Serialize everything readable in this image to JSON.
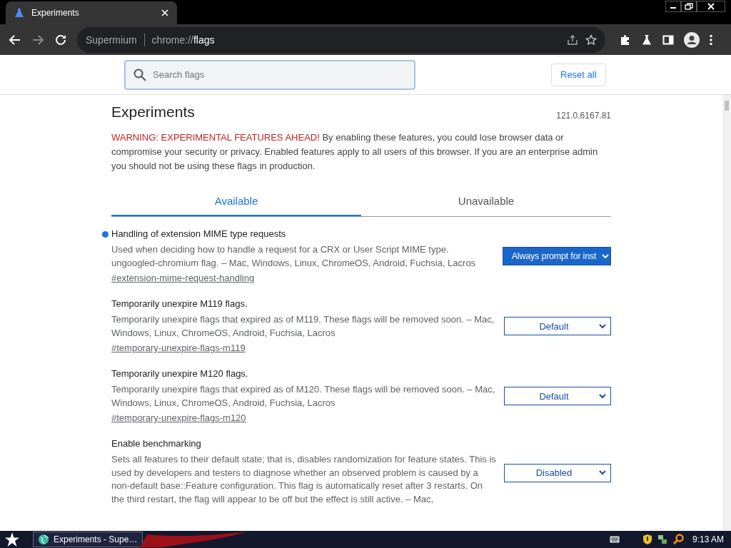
{
  "tab": {
    "title": "Experiments"
  },
  "omnibox": {
    "site": "Supermium",
    "url_prefix": "chrome://",
    "url_host": "flags"
  },
  "search": {
    "placeholder": "Search flags"
  },
  "reset_button": "Reset all",
  "page": {
    "title": "Experiments",
    "version": "121.0.6167.81",
    "warning": "WARNING: EXPERIMENTAL FEATURES AHEAD!",
    "warning_text": "By enabling these features, you could lose browser data or compromise your security or privacy. Enabled features apply to all users of this browser. If you are an enterprise admin you should not be using these flags in production."
  },
  "tabs": [
    {
      "label": "Available",
      "selected": true
    },
    {
      "label": "Unavailable",
      "selected": false
    }
  ],
  "flags": [
    {
      "name": "Handling of extension MIME type requests",
      "modified": true,
      "description": "Used when deciding how to handle a request for a CRX or User Script MIME type. ungoogled-chromium flag. – Mac, Windows, Linux, ChromeOS, Android, Fuchsia, Lacros",
      "link": "#extension-mime-request-handling",
      "value": "Always prompt for inst"
    },
    {
      "name": "Temporarily unexpire M119 flags.",
      "modified": false,
      "description": "Temporarily unexpire flags that expired as of M119. These flags will be removed soon. – Mac, Windows, Linux, ChromeOS, Android, Fuchsia, Lacros",
      "link": "#temporary-unexpire-flags-m119",
      "value": "Default"
    },
    {
      "name": "Temporarily unexpire M120 flags.",
      "modified": false,
      "description": "Temporarily unexpire flags that expired as of M120. These flags will be removed soon. – Mac, Windows, Linux, ChromeOS, Android, Fuchsia, Lacros",
      "link": "#temporary-unexpire-flags-m120",
      "value": "Default"
    },
    {
      "name": "Enable benchmarking",
      "modified": false,
      "description": "Sets all features to their default state; that is, disables randomization for feature states. This is used by developers and testers to diagnose whether an observed problem is caused by a non-default base::Feature configuration. This flag is automatically reset after 3 restarts. On the third restart, the flag will appear to be off but the effect is still active. – Mac,",
      "value": "Disabled"
    }
  ],
  "taskbar": {
    "task": "Experiments - Supe…",
    "clock": "9:13 AM"
  }
}
